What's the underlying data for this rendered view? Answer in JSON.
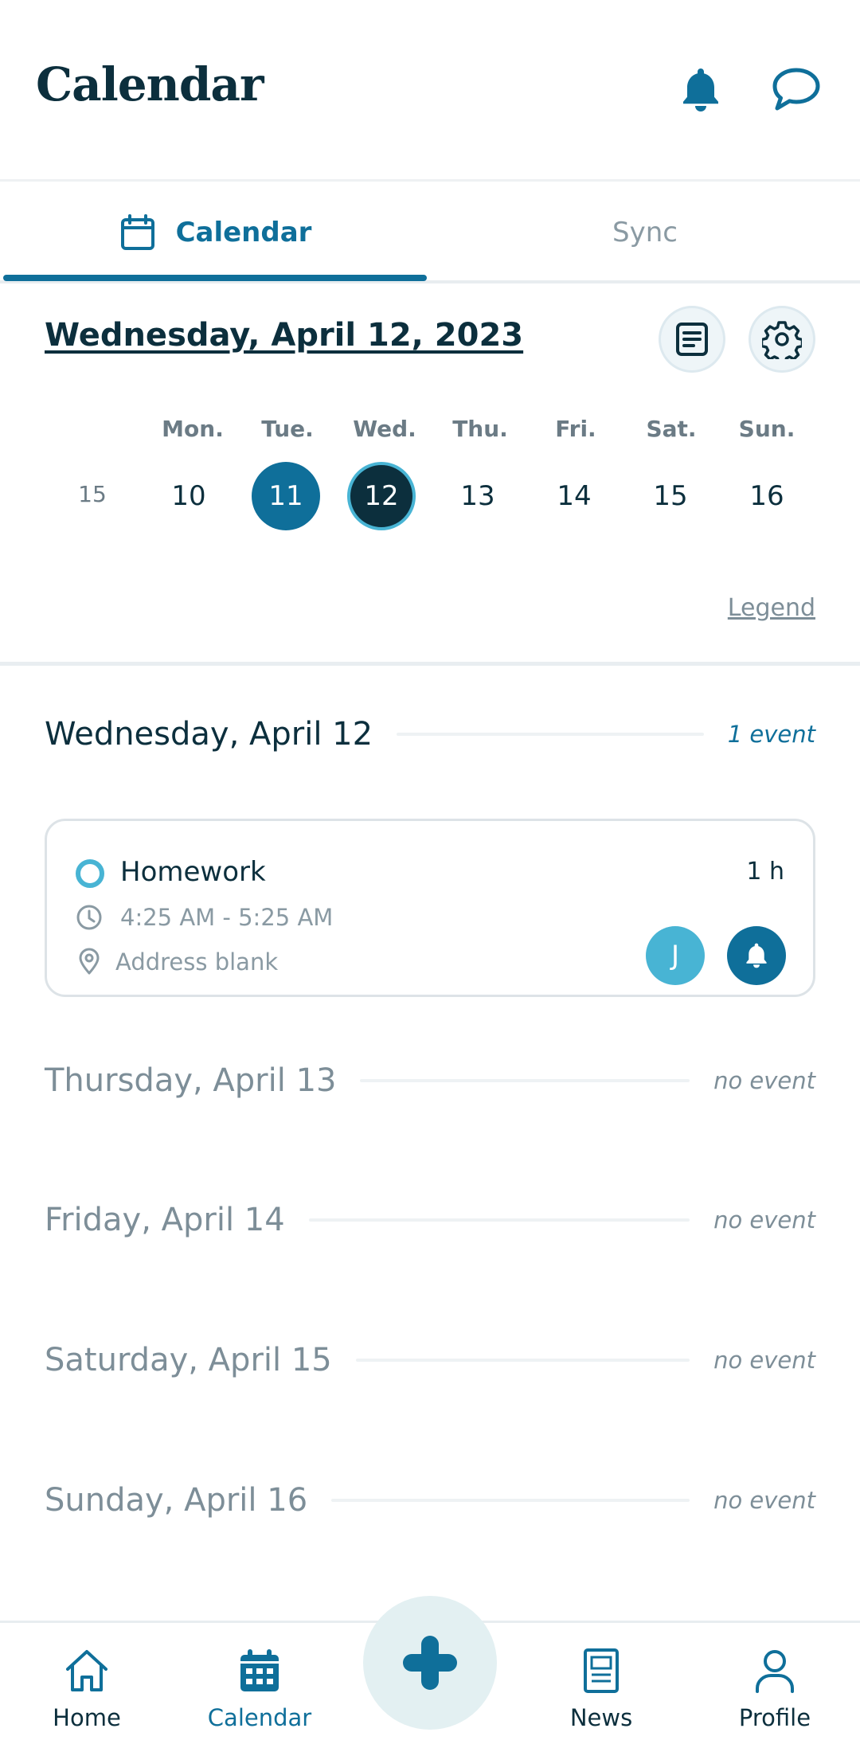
{
  "header": {
    "title": "Calendar",
    "notification_icon": "bell-icon",
    "messages_icon": "chat-bubble-icon"
  },
  "tabs": [
    {
      "label": "Calendar",
      "icon": "calendar-icon",
      "active": true
    },
    {
      "label": "Sync",
      "active": false
    }
  ],
  "week": {
    "selected_date": "Wednesday, April 12, 2023",
    "week_number": "15",
    "weekdays": [
      "Mon.",
      "Tue.",
      "Wed.",
      "Thu.",
      "Fri.",
      "Sat.",
      "Sun."
    ],
    "days": [
      "10",
      "11",
      "12",
      "13",
      "14",
      "15",
      "16"
    ],
    "today": "11",
    "selected": "12",
    "legend_label": "Legend",
    "notes_icon": "document-icon",
    "settings_icon": "gear-icon"
  },
  "agenda": [
    {
      "label": "Wednesday, April 12",
      "count": "1 event"
    },
    {
      "label": "Thursday, April 13",
      "count": "no event"
    },
    {
      "label": "Friday, April 14",
      "count": "no event"
    },
    {
      "label": "Saturday, April 15",
      "count": "no event"
    },
    {
      "label": "Sunday, April 16",
      "count": "no event"
    }
  ],
  "event": {
    "title": "Homework",
    "duration": "1 h",
    "time": "4:25 AM - 5:25 AM",
    "address": "Address blank",
    "avatar_initial": "J"
  },
  "bottom_nav": [
    {
      "label": "Home",
      "icon": "home-icon"
    },
    {
      "label": "Calendar",
      "icon": "calendar-icon",
      "active": true
    },
    {
      "label": "",
      "icon": "plus-icon"
    },
    {
      "label": "News",
      "icon": "news-icon"
    },
    {
      "label": "Profile",
      "icon": "user-icon"
    }
  ],
  "colors": {
    "primary": "#0f6f9a",
    "dark": "#0c2f3d",
    "accent": "#48b4d4",
    "muted": "#7d8e98"
  }
}
